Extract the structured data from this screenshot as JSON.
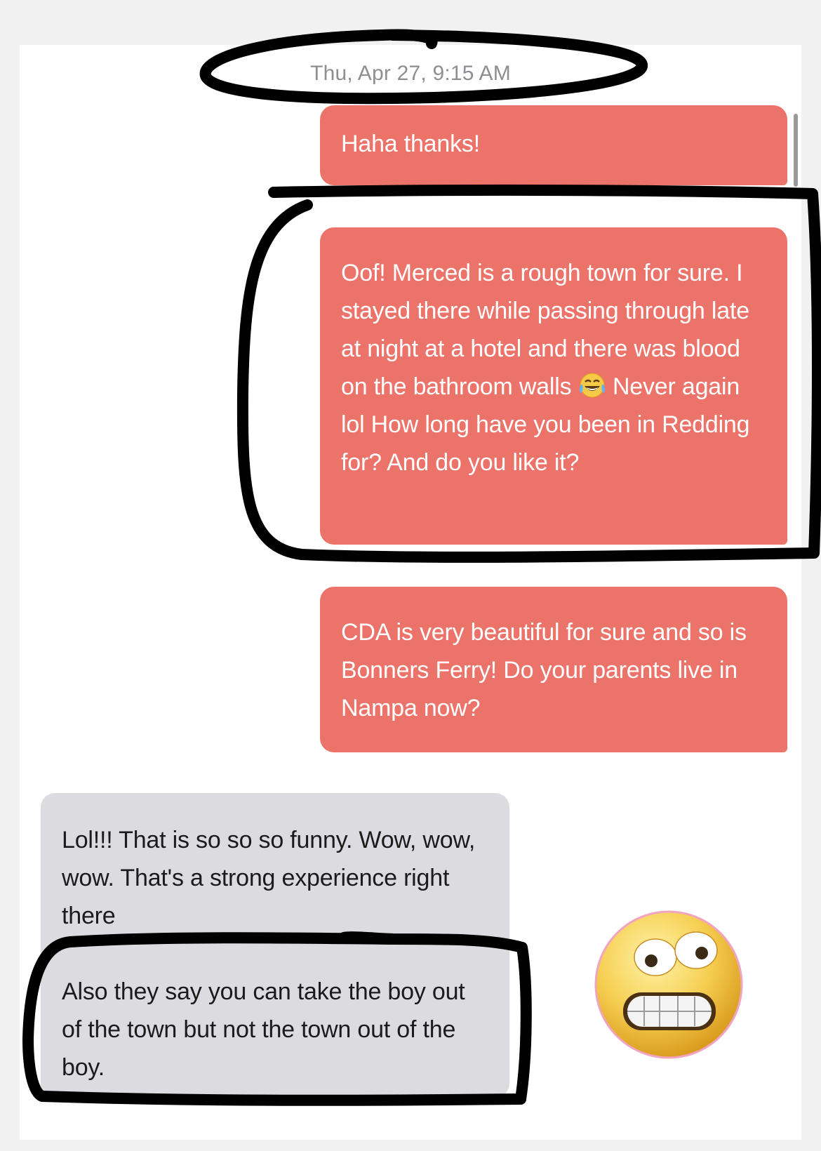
{
  "conversation": {
    "timestamp": "Thu, Apr 27, 9:15 AM",
    "messages": [
      {
        "direction": "outgoing",
        "text": "Haha thanks!"
      },
      {
        "direction": "outgoing",
        "text_before_emoji": "Oof! Merced is a rough town for sure. I stayed there while passing through late at night at a hotel and there was blood on the bathroom walls",
        "emoji": "tears-of-joy-emoji",
        "text_after_emoji": "Never again lol How long have you been in Redding for? And do you like it?"
      },
      {
        "direction": "outgoing",
        "text": "CDA is very beautiful for sure and so is Bonners Ferry! Do your parents live in Nampa now?"
      },
      {
        "direction": "incoming",
        "paragraphs": [
          "Lol!!! That is so so so funny. Wow, wow, wow. That's a strong experience right there",
          "Also they say you can take the boy out of the town but not the town out of the boy."
        ]
      }
    ],
    "reaction_emoji": "grimacing-face-emoji"
  },
  "colors": {
    "outgoing_bubble": "#ec736a",
    "incoming_bubble": "#dcdbe0",
    "annotation_ink": "#000000"
  }
}
